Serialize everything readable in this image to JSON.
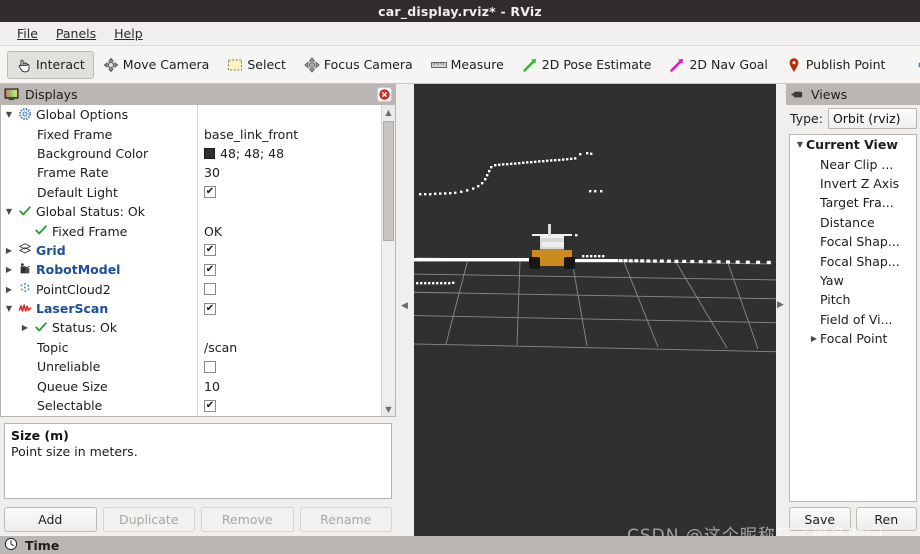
{
  "window": {
    "title": "car_display.rviz* - RViz"
  },
  "menubar": {
    "items": [
      {
        "label": "File",
        "accel": "F"
      },
      {
        "label": "Panels",
        "accel": "P"
      },
      {
        "label": "Help",
        "accel": "H"
      }
    ]
  },
  "toolbar": {
    "items": [
      {
        "label": "Interact",
        "icon": "hand-cursor-icon",
        "active": true
      },
      {
        "label": "Move Camera",
        "icon": "move-camera-icon",
        "active": false
      },
      {
        "label": "Select",
        "icon": "select-rect-icon",
        "active": false
      },
      {
        "label": "Focus Camera",
        "icon": "focus-camera-icon",
        "active": false
      },
      {
        "label": "Measure",
        "icon": "ruler-icon",
        "active": false
      },
      {
        "label": "2D Pose Estimate",
        "icon": "green-arrow-icon",
        "active": false
      },
      {
        "label": "2D Nav Goal",
        "icon": "magenta-arrow-icon",
        "active": false
      },
      {
        "label": "Publish Point",
        "icon": "map-pin-icon",
        "active": false
      }
    ],
    "add_tool_label": "+",
    "remove_tool_label": "-"
  },
  "displays": {
    "panel_title": "Displays",
    "panel_icon": "monitor-icon",
    "close_icon": "close-icon",
    "rows": [
      {
        "name": "Global Options",
        "indent": 0,
        "expander": "down",
        "icon": "gear-icon",
        "style": "plain",
        "value_type": "none"
      },
      {
        "name": "Fixed Frame",
        "indent": 1,
        "expander": "none",
        "icon": "none",
        "style": "plain",
        "value_type": "text",
        "value": "base_link_front"
      },
      {
        "name": "Background Color",
        "indent": 1,
        "expander": "none",
        "icon": "none",
        "style": "plain",
        "value_type": "color",
        "value": "48; 48; 48",
        "color": "#303030"
      },
      {
        "name": "Frame Rate",
        "indent": 1,
        "expander": "none",
        "icon": "none",
        "style": "plain",
        "value_type": "text",
        "value": "30"
      },
      {
        "name": "Default Light",
        "indent": 1,
        "expander": "none",
        "icon": "none",
        "style": "plain",
        "value_type": "check",
        "checked": true
      },
      {
        "name": "Global Status: Ok",
        "indent": 0,
        "expander": "down",
        "icon": "check-icon",
        "style": "plain",
        "value_type": "none"
      },
      {
        "name": "Fixed Frame",
        "indent": 1,
        "expander": "none",
        "icon": "check-icon",
        "style": "plain",
        "value_type": "text",
        "value": "OK"
      },
      {
        "name": "Grid",
        "indent": 0,
        "expander": "right",
        "icon": "grid-icon",
        "style": "blue",
        "value_type": "check",
        "checked": true
      },
      {
        "name": "RobotModel",
        "indent": 0,
        "expander": "right",
        "icon": "robot-icon",
        "style": "blue",
        "value_type": "check",
        "checked": true
      },
      {
        "name": "PointCloud2",
        "indent": 0,
        "expander": "right",
        "icon": "pointcloud-icon",
        "style": "plain",
        "value_type": "check",
        "checked": false
      },
      {
        "name": "LaserScan",
        "indent": 0,
        "expander": "down",
        "icon": "laserscan-icon",
        "style": "blue",
        "value_type": "check",
        "checked": true
      },
      {
        "name": "Status: Ok",
        "indent": 1,
        "expander": "right",
        "icon": "check-icon",
        "style": "plain",
        "value_type": "none"
      },
      {
        "name": "Topic",
        "indent": 1,
        "expander": "none",
        "icon": "none",
        "style": "plain",
        "value_type": "text",
        "value": "/scan"
      },
      {
        "name": "Unreliable",
        "indent": 1,
        "expander": "none",
        "icon": "none",
        "style": "plain",
        "value_type": "check",
        "checked": false
      },
      {
        "name": "Queue Size",
        "indent": 1,
        "expander": "none",
        "icon": "none",
        "style": "plain",
        "value_type": "text",
        "value": "10"
      },
      {
        "name": "Selectable",
        "indent": 1,
        "expander": "none",
        "icon": "none",
        "style": "plain",
        "value_type": "check",
        "checked": true
      }
    ],
    "description": {
      "title": "Size (m)",
      "body": "Point size in meters."
    },
    "buttons": [
      {
        "label": "Add",
        "enabled": true
      },
      {
        "label": "Duplicate",
        "enabled": false
      },
      {
        "label": "Remove",
        "enabled": false
      },
      {
        "label": "Rename",
        "enabled": false
      }
    ]
  },
  "views": {
    "panel_title": "Views",
    "panel_icon": "views-camera-icon",
    "type_label": "Type:",
    "type_value": "Orbit (rviz)",
    "rows": [
      {
        "name": "Current View",
        "indent": 0,
        "expander": "down",
        "style": "bold"
      },
      {
        "name": "Near Clip ...",
        "indent": 1,
        "expander": "none",
        "style": "plain"
      },
      {
        "name": "Invert Z Axis",
        "indent": 1,
        "expander": "none",
        "style": "plain"
      },
      {
        "name": "Target Fra...",
        "indent": 1,
        "expander": "none",
        "style": "plain"
      },
      {
        "name": "Distance",
        "indent": 1,
        "expander": "none",
        "style": "plain"
      },
      {
        "name": "Focal Shap...",
        "indent": 1,
        "expander": "none",
        "style": "plain"
      },
      {
        "name": "Focal Shap...",
        "indent": 1,
        "expander": "none",
        "style": "plain"
      },
      {
        "name": "Yaw",
        "indent": 1,
        "expander": "none",
        "style": "plain"
      },
      {
        "name": "Pitch",
        "indent": 1,
        "expander": "none",
        "style": "plain"
      },
      {
        "name": "Field of Vi...",
        "indent": 1,
        "expander": "none",
        "style": "plain"
      },
      {
        "name": "Focal Point",
        "indent": 1,
        "expander": "right",
        "style": "plain"
      }
    ],
    "buttons": [
      {
        "label": "Save",
        "enabled": true
      },
      {
        "label": "Ren",
        "enabled": true
      }
    ]
  },
  "timebar": {
    "label": "Time",
    "icon": "clock-icon"
  },
  "viewport": {
    "background_color": "#303030",
    "grid_color": "#9a9a9a",
    "laser_color": "#ffffff",
    "robot_body_color": "#c98a1e",
    "robot_top_color": "#d8d8d8",
    "robot_wheel_color": "#161616"
  },
  "watermark": {
    "text": "CSDN @这个昵称花了很多时间"
  }
}
